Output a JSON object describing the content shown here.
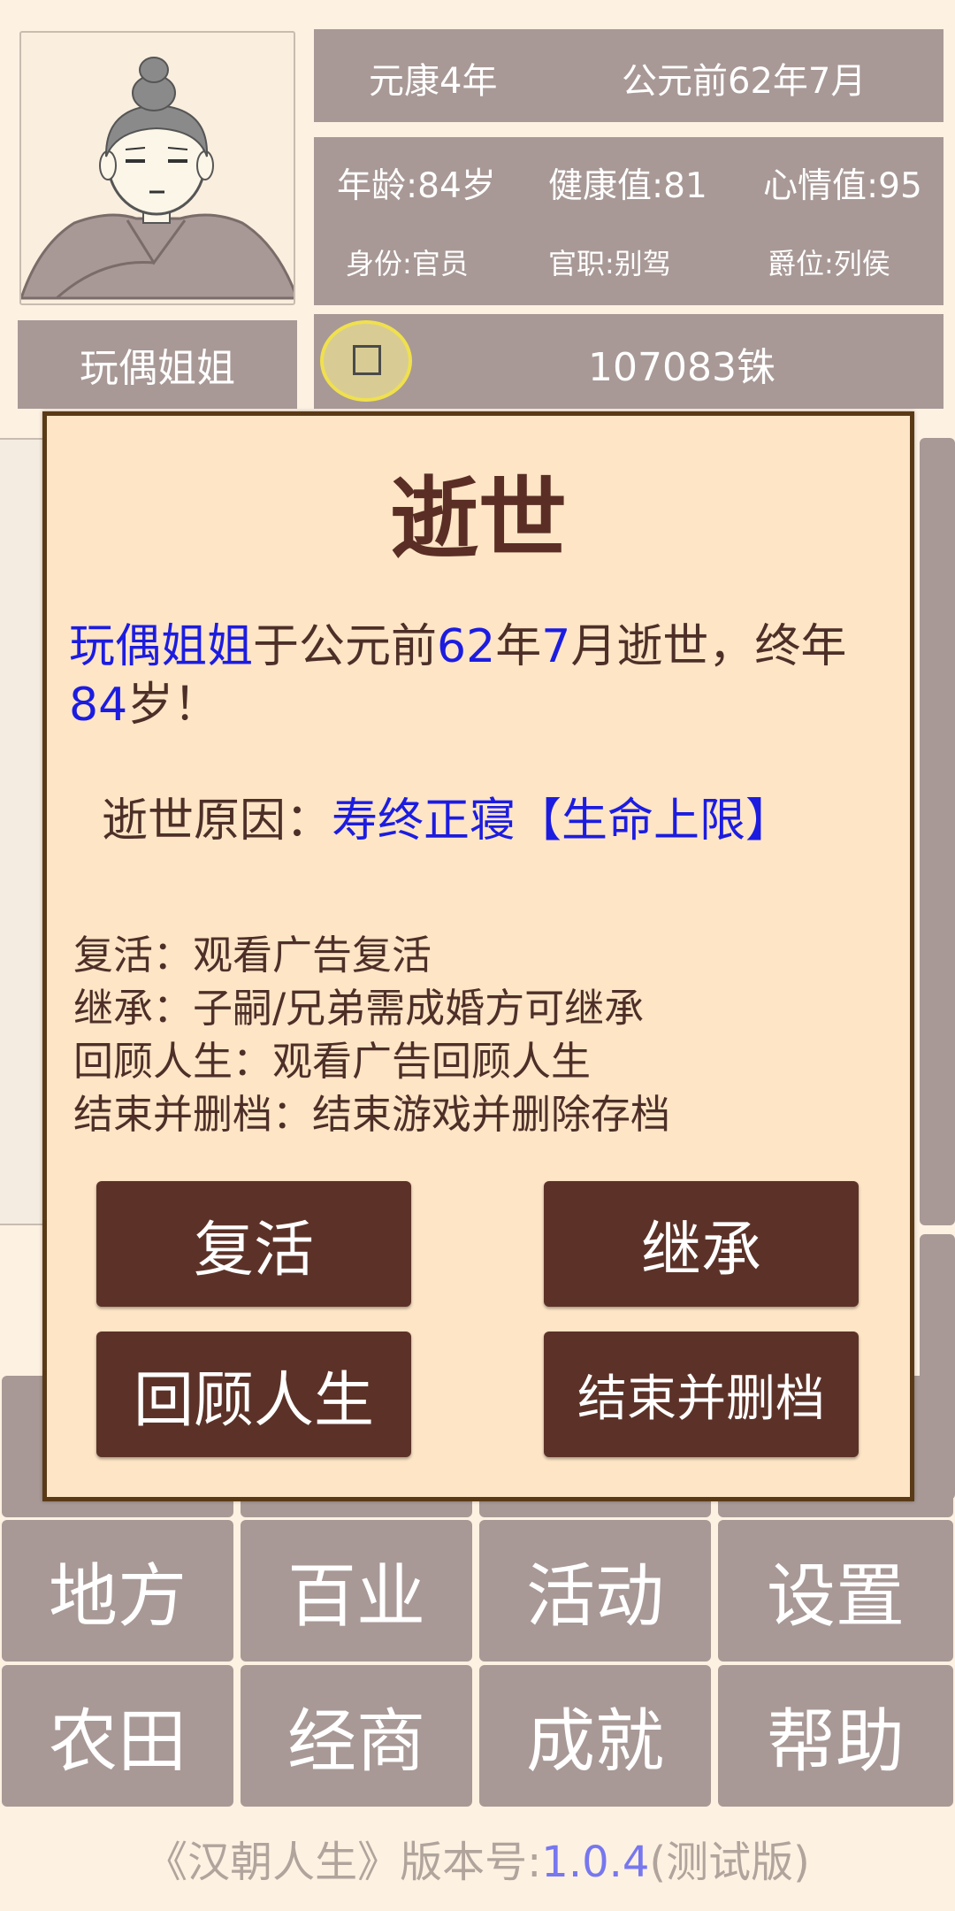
{
  "header": {
    "era": "元康4年",
    "date": "公元前62年7月",
    "age": "年龄:84岁",
    "health": "健康值:81",
    "mood": "心情值:95",
    "identity": "身份:官员",
    "office": "官职:别驾",
    "rank": "爵位:列侯",
    "name": "玩偶姐姐",
    "money": "107083铢"
  },
  "dialog": {
    "title": "逝世",
    "msg_name": "玩偶姐姐",
    "msg_part1": "于公元前",
    "msg_year": "62",
    "msg_part2": "年",
    "msg_month": "7",
    "msg_part3": "月逝世，终年",
    "msg_age": "84",
    "msg_part4": "岁！",
    "cause_label": "逝世原因：",
    "cause_value": "寿终正寝【生命上限】",
    "options": [
      "复活：观看广告复活",
      "继承：子嗣/兄弟需成婚方可继承",
      "回顾人生：观看广告回顾人生",
      "结束并删档：结束游戏并删除存档"
    ],
    "buttons": {
      "revive": "复活",
      "inherit": "继承",
      "review": "回顾人生",
      "end": "结束并删档"
    }
  },
  "menu": {
    "row1": [
      "地方",
      "百业",
      "活动",
      "设置"
    ],
    "row2": [
      "农田",
      "经商",
      "成就",
      "帮助"
    ]
  },
  "footer": {
    "prefix": "《汉朝人生》版本号:",
    "version": "1.0.4",
    "suffix": "(测试版)"
  },
  "colors": {
    "panel": "#a89996",
    "dialog_bg": "#fde5c6",
    "dialog_border": "#5a3a16",
    "button": "#5c3228",
    "highlight": "#1c1ce0",
    "version": "#7777ee"
  },
  "icons": {
    "portrait": "character-portrait-icon",
    "coin": "coin-icon"
  }
}
